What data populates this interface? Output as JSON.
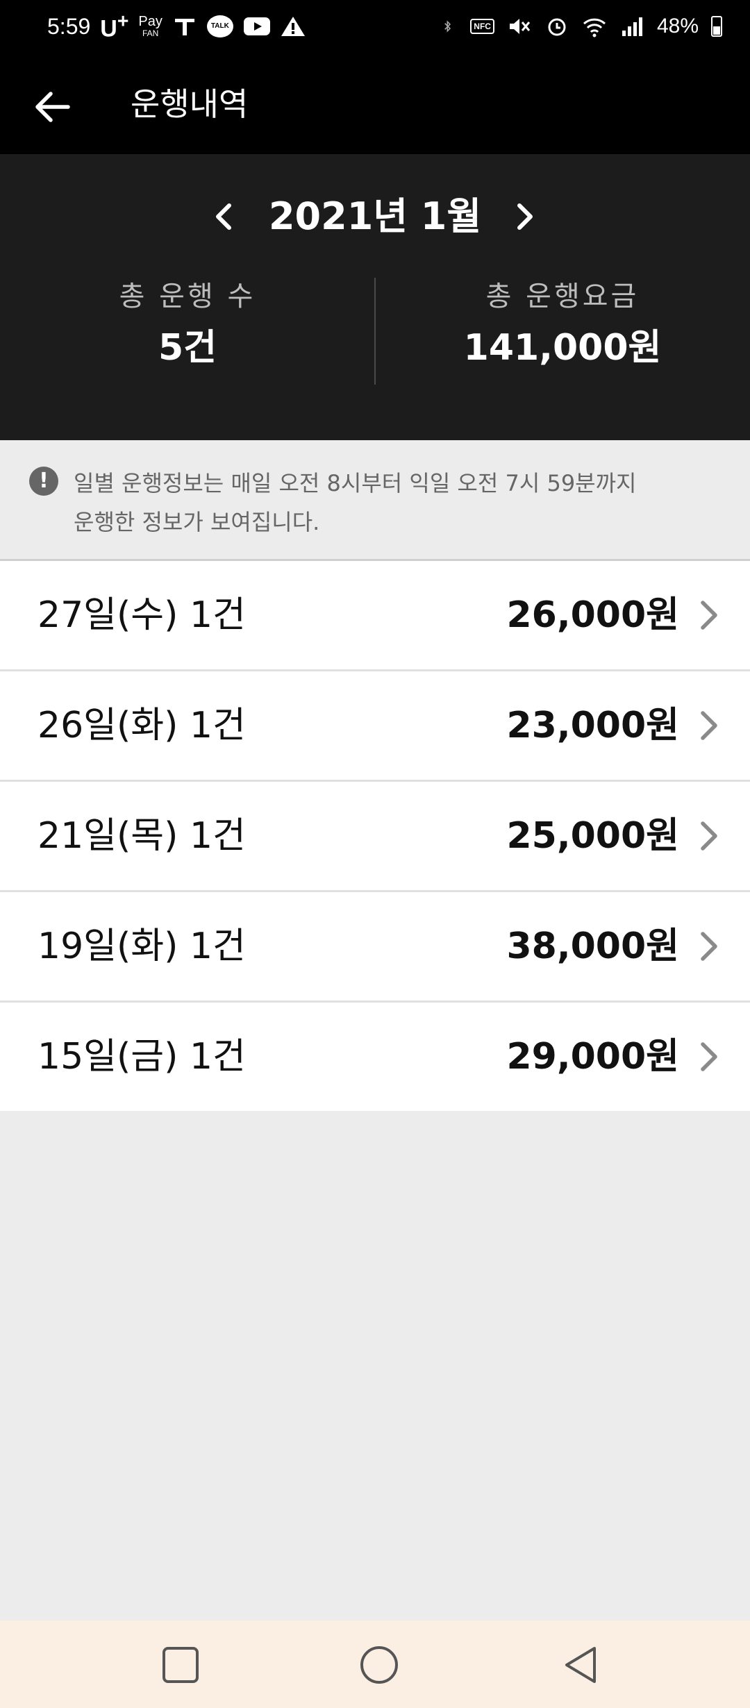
{
  "status_bar": {
    "time": "5:59",
    "brand": "U",
    "brand_sup": "+",
    "pay_top": "Pay",
    "pay_bottom": "FAN",
    "talk": "TALK",
    "nfc": "NFC",
    "battery": "48%",
    "icons": [
      "tmap-icon",
      "kakaotalk-icon",
      "youtube-icon",
      "warning-icon",
      "bluetooth-icon",
      "nfc-icon",
      "mute-icon",
      "alarm-icon",
      "wifi-icon",
      "signal-icon",
      "battery-icon"
    ]
  },
  "app_bar": {
    "title": "운행내역",
    "back_icon": "arrow-left-icon"
  },
  "summary": {
    "month": "2021년 1월",
    "total_rides_label": "총 운행 수",
    "total_rides_value": "5건",
    "total_fare_label": "총 운행요금",
    "total_fare_value": "141,000원"
  },
  "notice": {
    "line1": "일별 운행정보는 매일 오전 8시부터 익일 오전 7시 59분까지",
    "line2": "운행한 정보가 보여집니다."
  },
  "rides": [
    {
      "date": "27일(수) 1건",
      "fare": "26,000원"
    },
    {
      "date": "26일(화) 1건",
      "fare": "23,000원"
    },
    {
      "date": "21일(목) 1건",
      "fare": "25,000원"
    },
    {
      "date": "19일(화) 1건",
      "fare": "38,000원"
    },
    {
      "date": "15일(금) 1건",
      "fare": "29,000원"
    }
  ],
  "colors": {
    "app_bar_bg": "#000000",
    "summary_bg": "#1c1c1c",
    "page_bg": "#ececec",
    "nav_bar_bg": "#fbeee3",
    "chevron": "#8a8a8a"
  }
}
